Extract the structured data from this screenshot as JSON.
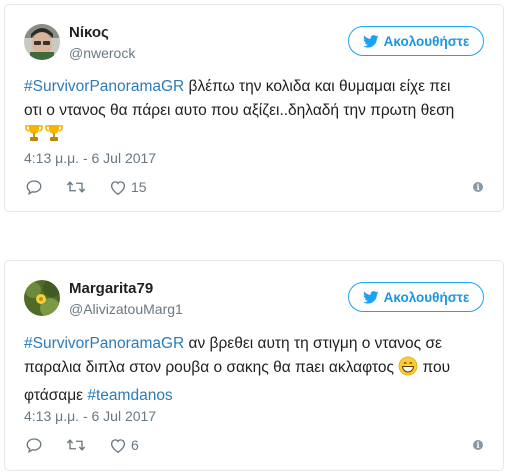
{
  "tweets": [
    {
      "author": {
        "name": "Νίκος",
        "handle": "@nwerock"
      },
      "follow_label": "Ακολουθήστε",
      "body": {
        "hashtag": "#SurvivorPanoramaGR",
        "line1_rest": " βλέπω την κολιδα και θυμαμαι είχε πει",
        "line2": "οτι ο ντανος θα πάρει αυτο που αξίζει..δηλαδή την πρωτη θεση",
        "emojis": [
          "trophy",
          "trophy"
        ]
      },
      "timestamp": "4:13 μ.μ. - 6 Jul 2017",
      "actions": {
        "reply_icon": "reply-icon",
        "retweet_icon": "retweet-icon",
        "like_icon": "heart-icon",
        "like_count": "15"
      }
    },
    {
      "author": {
        "name": "Margarita79",
        "handle": "@AlivizatouMarg1"
      },
      "follow_label": "Ακολουθήστε",
      "body": {
        "hashtag": "#SurvivorPanoramaGR",
        "line1_rest": " αν βρεθει αυτη τη στιγμη ο ντανος σε",
        "line2": "παραλια διπλα στον ρουβα ο σακης θα πaει ακλαφτος ",
        "line2_end": " που",
        "line3_prefix": "φτάσαμε ",
        "hashtag2": "#teamdanos",
        "emoji": "grinning-face"
      },
      "timestamp": "4:13 μ.μ. - 6 Jul 2017",
      "actions": {
        "reply_icon": "reply-icon",
        "retweet_icon": "retweet-icon",
        "like_icon": "heart-icon",
        "like_count": "6"
      }
    }
  ],
  "colors": {
    "link": "#2b7bb9",
    "follow_border": "#1da1f2",
    "secondary_text": "#697882",
    "border": "#e1e8ed"
  }
}
